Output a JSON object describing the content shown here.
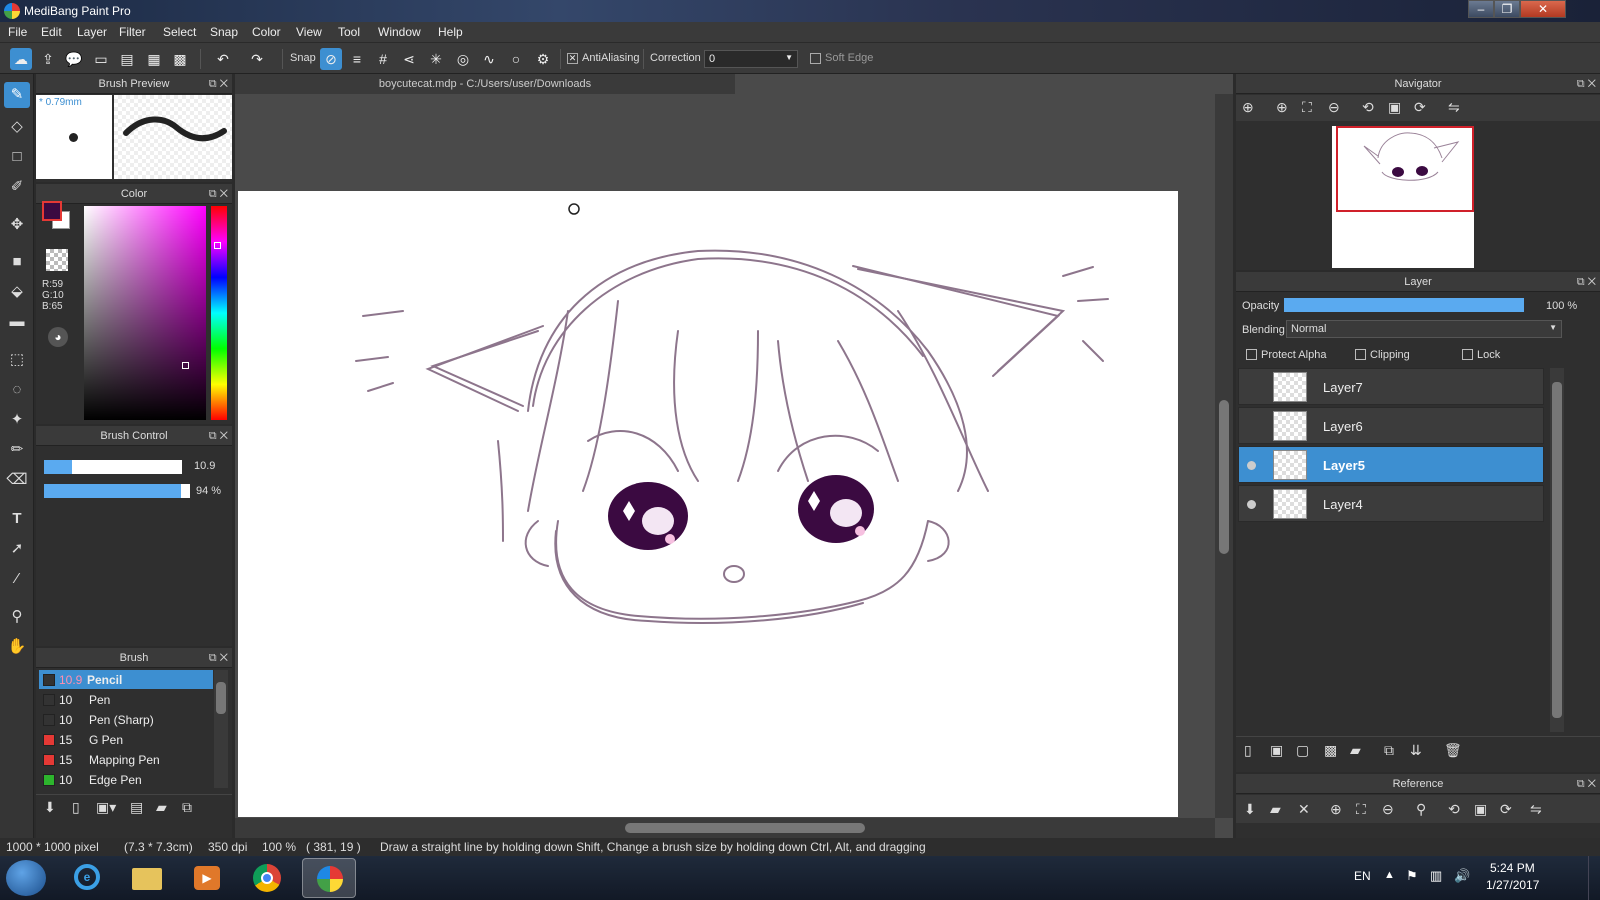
{
  "window": {
    "title": "MediBang Paint Pro"
  },
  "menu": [
    "File",
    "Edit",
    "Layer",
    "Filter",
    "Select",
    "Snap",
    "Color",
    "View",
    "Tool",
    "Window",
    "Help"
  ],
  "toolbar": {
    "snap_label": "Snap",
    "antialiasing_label": "AntiAliasing",
    "antialiasing_checked": true,
    "correction_label": "Correction",
    "correction_value": "0",
    "soft_edge_label": "Soft Edge",
    "soft_edge_checked": false
  },
  "panels": {
    "brush_preview": {
      "title": "Brush Preview",
      "size": "* 0.79mm"
    },
    "color": {
      "title": "Color",
      "r": "R:59",
      "g": "G:10",
      "b": "B:65",
      "primary": "#3b0a41",
      "secondary": "#ffffff"
    },
    "brush_control": {
      "title": "Brush Control",
      "size_value": "10.9",
      "opacity_value": "94 %",
      "size_fraction": 0.2,
      "opacity_fraction": 0.94
    },
    "brush": {
      "title": "Brush",
      "items": [
        {
          "size": "10.9",
          "name": "Pencil",
          "color": "#333333",
          "selected": true
        },
        {
          "size": "10",
          "name": "Pen",
          "color": "#333333",
          "selected": false
        },
        {
          "size": "10",
          "name": "Pen (Sharp)",
          "color": "#333333",
          "selected": false
        },
        {
          "size": "15",
          "name": "G Pen",
          "color": "#e53935",
          "selected": false
        },
        {
          "size": "15",
          "name": "Mapping Pen",
          "color": "#e53935",
          "selected": false
        },
        {
          "size": "10",
          "name": "Edge Pen",
          "color": "#2db52d",
          "selected": false
        }
      ]
    },
    "navigator": {
      "title": "Navigator"
    },
    "layer": {
      "title": "Layer",
      "opacity_label": "Opacity",
      "opacity_value": "100 %",
      "blending_label": "Blending",
      "blending_value": "Normal",
      "protect_alpha_label": "Protect Alpha",
      "clipping_label": "Clipping",
      "lock_label": "Lock",
      "layers": [
        {
          "name": "Layer7",
          "visible": false,
          "selected": false
        },
        {
          "name": "Layer6",
          "visible": false,
          "selected": false
        },
        {
          "name": "Layer5",
          "visible": true,
          "selected": true
        },
        {
          "name": "Layer4",
          "visible": true,
          "selected": false
        }
      ]
    },
    "reference": {
      "title": "Reference"
    }
  },
  "document": {
    "tab": "boycutecat.mdp - C:/Users/user/Downloads"
  },
  "status": {
    "size": "1000 * 1000 pixel",
    "cm": "(7.3 * 7.3cm)",
    "dpi": "350 dpi",
    "zoom": "100 %",
    "coords": "( 381, 19 )",
    "hint": "Draw a straight line by holding down Shift, Change a brush size by holding down Ctrl, Alt, and dragging"
  },
  "taskbar": {
    "lang": "EN",
    "time": "5:24 PM",
    "date": "1/27/2017"
  }
}
